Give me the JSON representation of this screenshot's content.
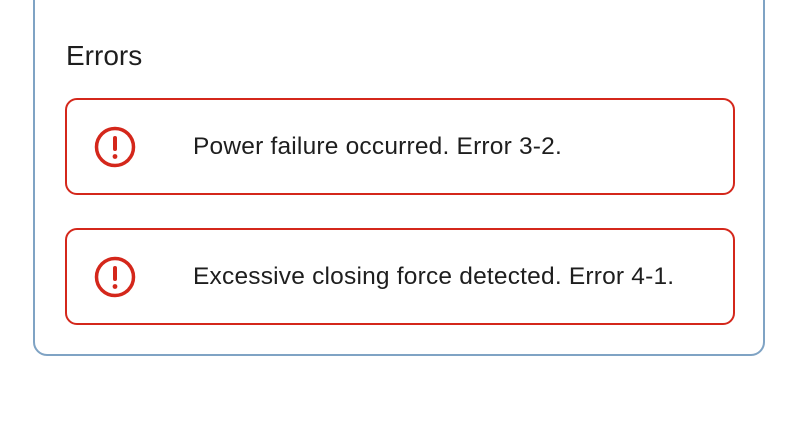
{
  "errors_section": {
    "title": "Errors",
    "items": [
      {
        "icon": "exclamation-circle-icon",
        "message": "Power failure occurred. Error 3-2."
      },
      {
        "icon": "exclamation-circle-icon",
        "message": "Excessive closing force detected. Error 4-1."
      }
    ]
  },
  "colors": {
    "error": "#d4271b",
    "panel_border": "#7fa3c4",
    "text": "#1e1e1e"
  }
}
